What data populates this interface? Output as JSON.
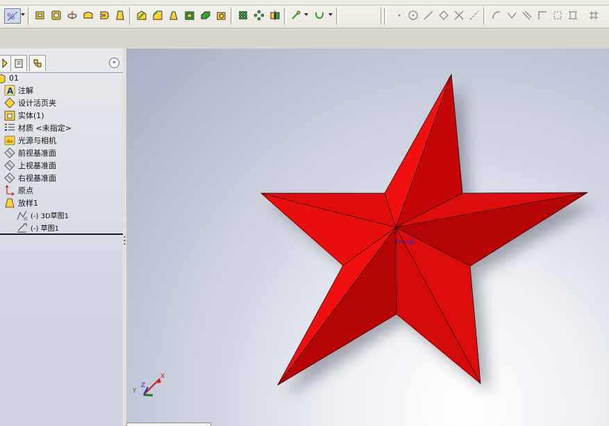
{
  "toolbar": {
    "buttons": [
      "sketch-relations-icon",
      "extruded-boss-icon",
      "revolved-boss-icon",
      "swept-boss-icon",
      "lofted-boss-icon",
      "boundary-boss-icon",
      "loft-icon",
      "fillet-icon",
      "chamfer-icon",
      "draft-icon",
      "shell-icon",
      "rib-icon",
      "linear-pattern-icon",
      "circular-pattern-icon",
      "mirror-icon",
      "reference-geometry-icon",
      "curves-icon"
    ],
    "sketch_tools": [
      "point-icon",
      "circle-icon",
      "line-icon",
      "polygon-icon",
      "trim-icon",
      "centerline-icon",
      "arc-icon",
      "dimension-icon",
      "smart-dimension-icon",
      "corner-rectangle-icon",
      "center-rectangle-icon",
      "grid-icon"
    ]
  },
  "feature_tree": {
    "root": "01",
    "items": [
      {
        "label": "注解",
        "icon": "annotations-icon"
      },
      {
        "label": "设计活页夹",
        "icon": "design-binder-icon"
      },
      {
        "label": "实体(1)",
        "icon": "solid-bodies-icon"
      },
      {
        "label": "材质 <未指定>",
        "icon": "material-icon"
      },
      {
        "label": "光源与相机",
        "icon": "lights-cameras-icon"
      },
      {
        "label": "前视基准面",
        "icon": "plane-icon"
      },
      {
        "label": "上视基准面",
        "icon": "plane-icon"
      },
      {
        "label": "右视基准面",
        "icon": "plane-icon"
      },
      {
        "label": "原点",
        "icon": "origin-icon"
      },
      {
        "label": "放样1",
        "icon": "loft-feature-icon"
      }
    ],
    "sub_items": [
      {
        "label": "(-) 3D草图1",
        "icon": "3d-sketch-icon"
      },
      {
        "label": "(-) 草图1",
        "icon": "sketch-icon"
      }
    ]
  },
  "viewport": {
    "model": "five-pointed-star",
    "colors": {
      "light_face": "#f01010",
      "mid_face": "#dc0c0c",
      "dark_face": "#b40404",
      "background_top": "#a9b0c4",
      "background_bottom": "#ffffff"
    },
    "triad_labels": {
      "x": "X",
      "y": "Y",
      "z": "Z"
    }
  }
}
